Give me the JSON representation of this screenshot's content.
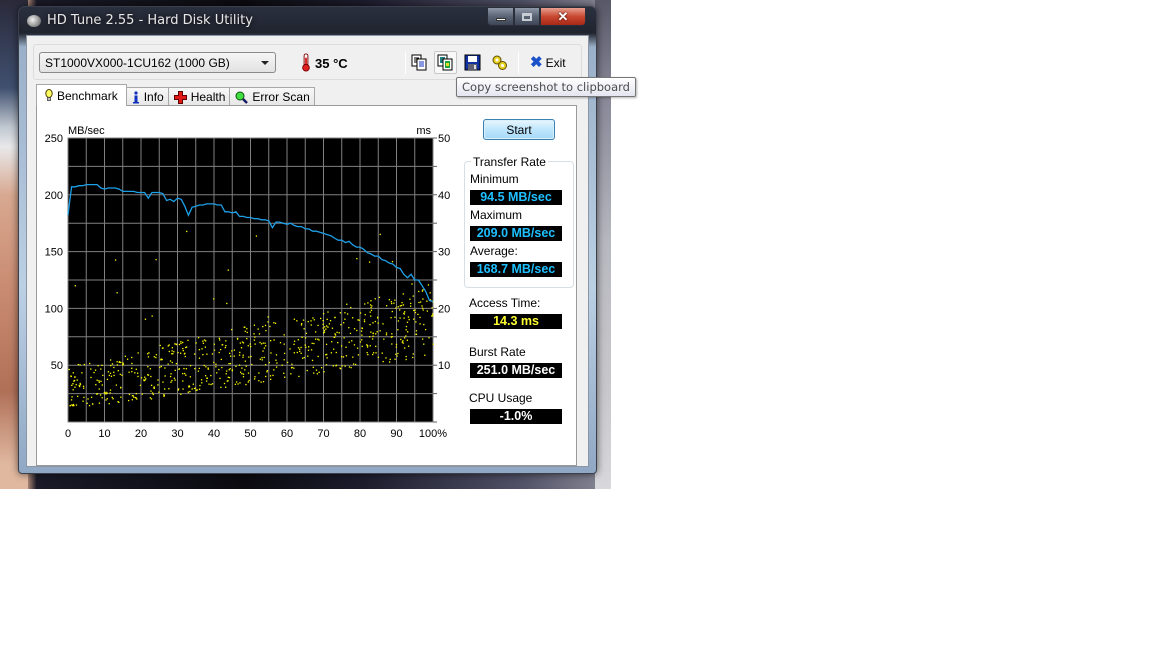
{
  "window": {
    "title": "HD Tune 2.55 - Hard Disk Utility",
    "caption_buttons": {
      "minimize": "minimize",
      "maximize": "maximize",
      "close": "✕"
    }
  },
  "toolbar": {
    "drive_selected": "ST1000VX000-1CU162 (1000 GB)",
    "temperature": "35 °C",
    "icons": [
      "copy-text-icon",
      "copy-screenshot-icon",
      "save-icon",
      "options-icon"
    ],
    "exit_label": "Exit",
    "tooltip": "Copy screenshot to clipboard"
  },
  "tabs": [
    {
      "label": "Benchmark",
      "icon": "lightbulb-icon",
      "active": true
    },
    {
      "label": "Info",
      "icon": "info-icon",
      "active": false
    },
    {
      "label": "Health",
      "icon": "health-cross-icon",
      "active": false
    },
    {
      "label": "Error Scan",
      "icon": "magnifier-icon",
      "active": false
    }
  ],
  "benchmark": {
    "start_label": "Start",
    "transfer_rate_title": "Transfer Rate",
    "minimum_label": "Minimum",
    "minimum_value": "94.5 MB/sec",
    "maximum_label": "Maximum",
    "maximum_value": "209.0 MB/sec",
    "average_label": "Average:",
    "average_value": "168.7 MB/sec",
    "access_time_label": "Access Time:",
    "access_time_value": "14.3 ms",
    "burst_rate_label": "Burst Rate",
    "burst_rate_value": "251.0 MB/sec",
    "cpu_usage_label": "CPU Usage",
    "cpu_usage_value": "-1.0%",
    "colors": {
      "transfer_line": "#1ea0e8",
      "access_points": "#ffff00",
      "grid": "#808080",
      "plot_bg": "#000000"
    }
  },
  "chart_data": {
    "type": "line",
    "title": "",
    "xlabel": "%",
    "ylabel_left": "MB/sec",
    "ylabel_right": "ms",
    "xlim": [
      0,
      100
    ],
    "ylim_left": [
      0,
      250
    ],
    "ylim_right": [
      0,
      50
    ],
    "x_ticks": [
      "0",
      "10",
      "20",
      "30",
      "40",
      "50",
      "60",
      "70",
      "80",
      "90",
      "100%"
    ],
    "y_ticks_left": [
      "250",
      "200",
      "150",
      "100",
      "50"
    ],
    "y_ticks_right": [
      "50",
      "40",
      "30",
      "20",
      "10"
    ],
    "grid": true,
    "series": [
      {
        "name": "Transfer Rate (MB/sec)",
        "axis": "left",
        "x": [
          0,
          0.5,
          1,
          2,
          3,
          4,
          5,
          6,
          7,
          8,
          9,
          10,
          11,
          12,
          13,
          14,
          15,
          16,
          17,
          18,
          19,
          20,
          21,
          22,
          23,
          24,
          25,
          26,
          27,
          28,
          29,
          30,
          31,
          32,
          33,
          34,
          35,
          36,
          37,
          38,
          39,
          40,
          41,
          42,
          43,
          44,
          45,
          46,
          47,
          48,
          49,
          50,
          51,
          52,
          53,
          54,
          55,
          56,
          57,
          58,
          59,
          60,
          61,
          62,
          63,
          64,
          65,
          66,
          67,
          68,
          69,
          70,
          71,
          72,
          73,
          74,
          75,
          76,
          77,
          78,
          79,
          80,
          81,
          82,
          83,
          84,
          85,
          86,
          87,
          88,
          89,
          90,
          91,
          92,
          93,
          94,
          95,
          96,
          97,
          98,
          99,
          100
        ],
        "values": [
          182,
          195,
          207,
          207,
          208,
          208,
          209,
          209,
          209,
          209,
          206,
          205,
          206,
          206,
          206,
          205,
          203,
          203,
          203,
          203,
          202,
          202,
          202,
          197,
          202,
          202,
          202,
          201,
          195,
          196,
          194,
          197,
          196,
          190,
          182,
          189,
          190,
          191,
          191,
          192,
          192,
          192,
          191,
          191,
          185,
          185,
          184,
          185,
          181,
          181,
          180,
          180,
          179,
          179,
          178,
          178,
          177,
          171,
          176,
          176,
          175,
          174,
          175,
          173,
          172,
          172,
          170,
          170,
          168,
          168,
          167,
          166,
          165,
          164,
          162,
          160,
          160,
          158,
          159,
          156,
          154,
          154,
          152,
          149,
          148,
          146,
          146,
          143,
          142,
          140,
          139,
          136,
          135,
          130,
          127,
          130,
          125,
          125,
          120,
          115,
          107,
          106
        ]
      },
      {
        "name": "Access Time (ms)",
        "axis": "right",
        "type": "scatter",
        "description": "scattered access time samples, roughly 4-12 ms near 0% rising to about 15-20 ms near 100%, with sparse outliers up to ~35 ms"
      }
    ]
  }
}
